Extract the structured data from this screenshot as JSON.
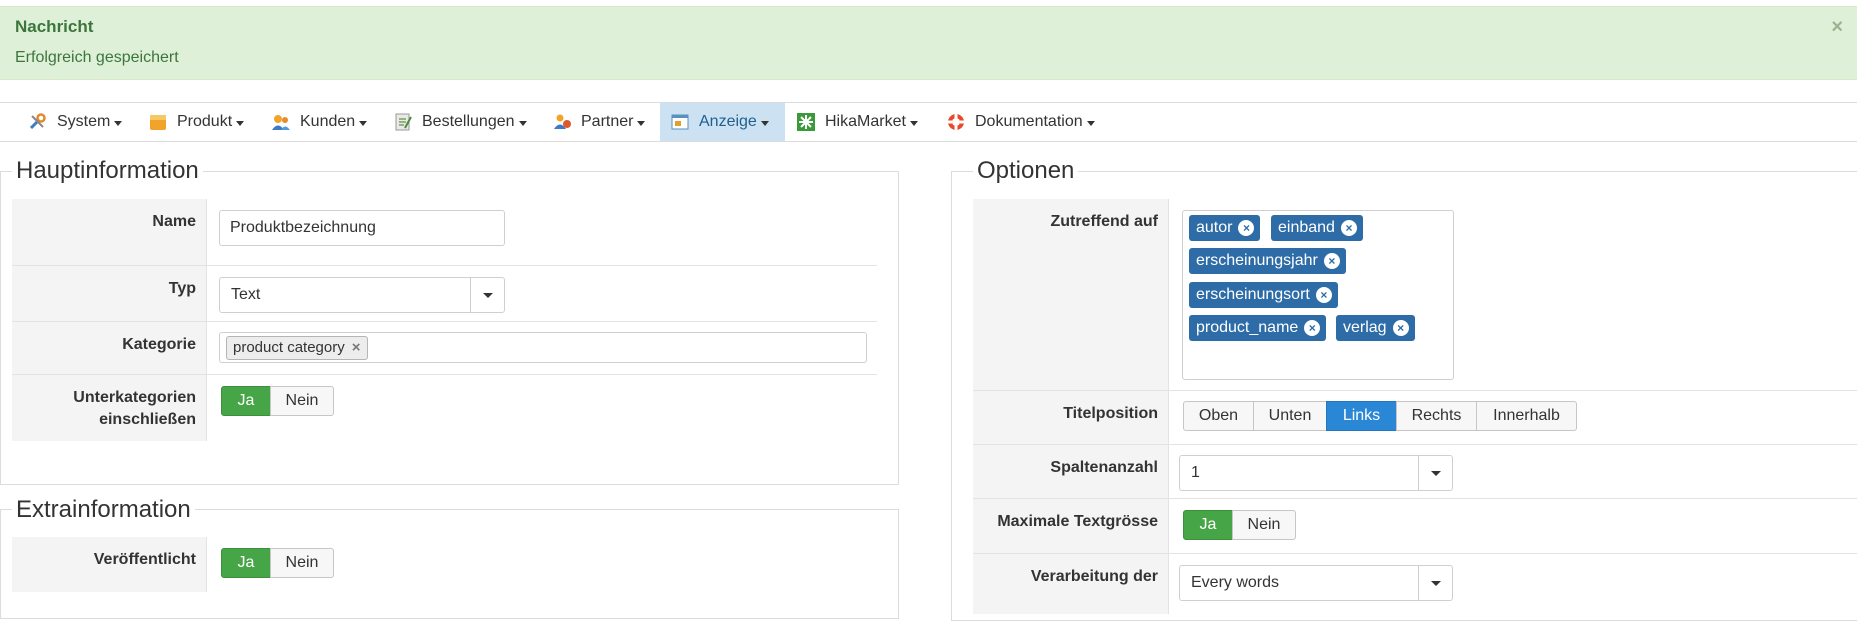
{
  "alert": {
    "heading": "Nachricht",
    "message": "Erfolgreich gespeichert",
    "close": "×"
  },
  "menu": [
    {
      "label": "System",
      "icon": "tools-icon"
    },
    {
      "label": "Produkt",
      "icon": "box-icon"
    },
    {
      "label": "Kunden",
      "icon": "users-icon"
    },
    {
      "label": "Bestellungen",
      "icon": "orders-icon"
    },
    {
      "label": "Partner",
      "icon": "partner-icon"
    },
    {
      "label": "Anzeige",
      "icon": "display-icon",
      "active": true
    },
    {
      "label": "HikaMarket",
      "icon": "hikamarket-icon"
    },
    {
      "label": "Dokumentation",
      "icon": "lifebuoy-icon"
    }
  ],
  "main": {
    "legend": "Hauptinformation",
    "name_label": "Name",
    "name_value": "Produktbezeichnung",
    "typ_label": "Typ",
    "typ_value": "Text",
    "kategorie_label": "Kategorie",
    "kategorie_chip": "product category",
    "chip_remove": "×",
    "unterkategorien_label_1": "Unterkategorien",
    "unterkategorien_label_2": "einschließen",
    "ja": "Ja",
    "nein": "Nein"
  },
  "extra": {
    "legend": "Extrainformation",
    "veroeffentlicht_label": "Veröffentlicht",
    "ja": "Ja",
    "nein": "Nein"
  },
  "options": {
    "legend": "Optionen",
    "zutreffend_label": "Zutreffend auf",
    "tags": [
      "autor",
      "einband",
      "erscheinungsjahr",
      "erscheinungsort",
      "product_name",
      "verlag"
    ],
    "tag_remove": "×",
    "titelposition_label": "Titelposition",
    "titelposition_options": [
      "Oben",
      "Unten",
      "Links",
      "Rechts",
      "Innerhalb"
    ],
    "titelposition_selected": "Links",
    "spaltenanzahl_label": "Spaltenanzahl",
    "spaltenanzahl_value": "1",
    "textgroesse_label": "Maximale Textgrösse",
    "ja": "Ja",
    "nein": "Nein",
    "verarbeitung_label": "Verarbeitung der",
    "verarbeitung_value": "Every words"
  },
  "colors": {
    "alert_bg": "#dff0d8",
    "alert_text": "#3c763d",
    "active_menu": "#cce2f2",
    "green": "#46a546",
    "blue": "#2a87d6",
    "tag": "#2d6ca7"
  }
}
